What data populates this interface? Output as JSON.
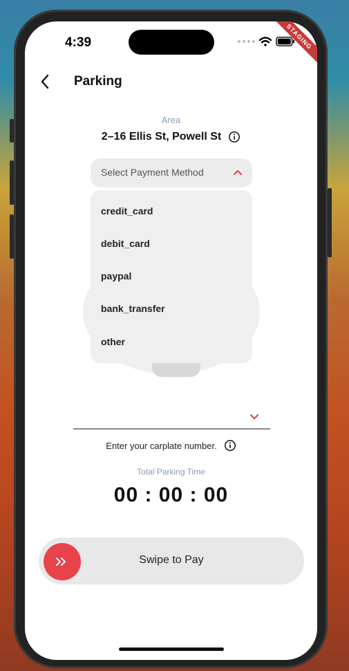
{
  "status_bar": {
    "time": "4:39",
    "badge": "STAGING"
  },
  "header": {
    "title": "Parking",
    "back_icon": "chevron-left-icon"
  },
  "area": {
    "label": "Area",
    "value": "2–16 Ellis St,  Powell St",
    "info_icon": "info-icon"
  },
  "payment_dropdown": {
    "label": "Select Payment Method",
    "expanded": true,
    "options": [
      "credit_card",
      "debit_card",
      "paypal",
      "bank_transfer",
      "other"
    ]
  },
  "carplate": {
    "hint": "Enter your carplate number."
  },
  "parking_time": {
    "label": "Total Parking Time",
    "value": "00 : 00 : 00"
  },
  "swipe": {
    "label": "Swipe to Pay",
    "knob_icon": "double-chevron-right-icon"
  },
  "colors": {
    "accent": "#e8434a",
    "muted_label": "#8a9bb5",
    "staging": "#c73a3a"
  }
}
